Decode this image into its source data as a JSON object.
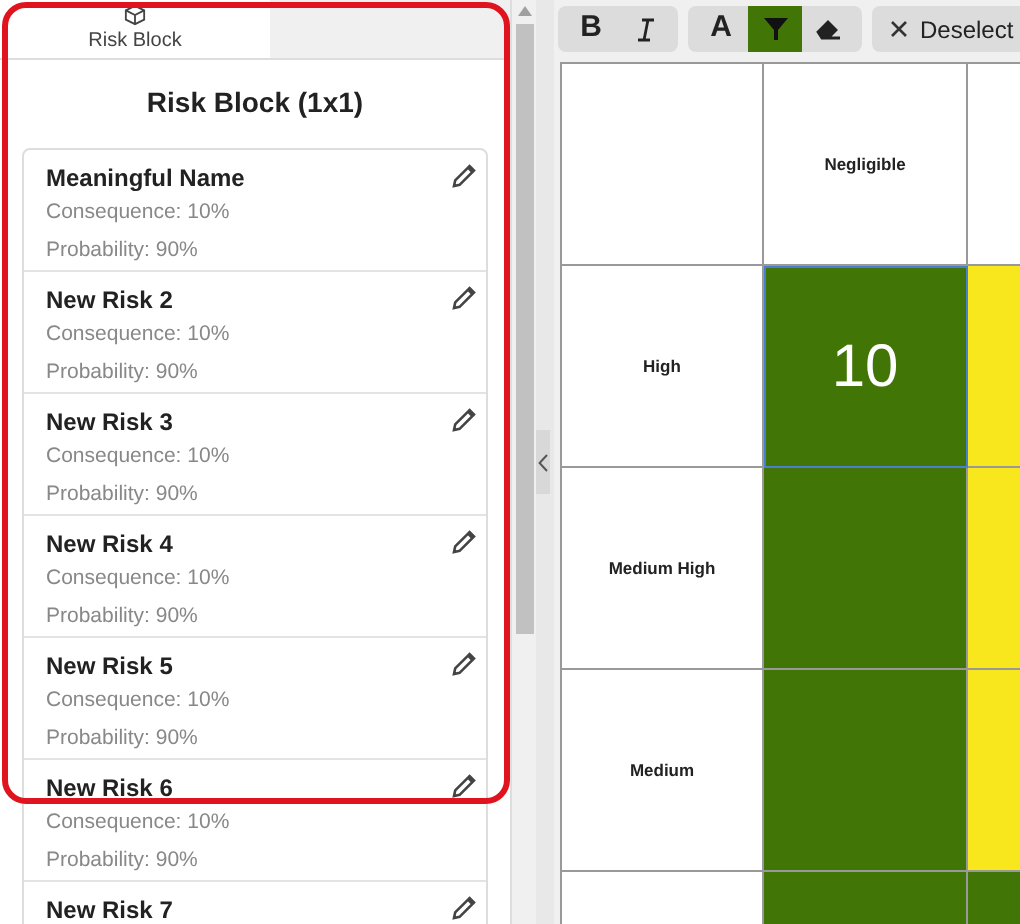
{
  "sidebar": {
    "tabs": [
      {
        "label": "Risk Block",
        "selected": true
      }
    ],
    "title": "Risk Block (1x1)",
    "highlighted": true,
    "risks": [
      {
        "name": "Meaningful Name",
        "consequence": "Consequence: 10%",
        "probability": "Probability: 90%"
      },
      {
        "name": "New Risk 2",
        "consequence": "Consequence: 10%",
        "probability": "Probability: 90%"
      },
      {
        "name": "New Risk 3",
        "consequence": "Consequence: 10%",
        "probability": "Probability: 90%"
      },
      {
        "name": "New Risk 4",
        "consequence": "Consequence: 10%",
        "probability": "Probability: 90%"
      },
      {
        "name": "New Risk 5",
        "consequence": "Consequence: 10%",
        "probability": "Probability: 90%"
      },
      {
        "name": "New Risk 6",
        "consequence": "Consequence: 10%",
        "probability": "Probability: 90%"
      },
      {
        "name": "New Risk 7"
      }
    ]
  },
  "toolbar": {
    "groups": [
      [
        {
          "kind": "bold",
          "glyph": "B",
          "selected": false
        },
        {
          "kind": "italic",
          "selected": false
        }
      ],
      [
        {
          "kind": "text-color",
          "glyph": "A",
          "selected": false
        },
        {
          "kind": "fill-color",
          "selected": true
        },
        {
          "kind": "eraser",
          "selected": false
        }
      ],
      [
        {
          "kind": "deselect",
          "label": "Deselect",
          "selected": false
        }
      ]
    ]
  },
  "matrix": {
    "column_headers": [
      "Negligible"
    ],
    "rows": [
      {
        "label": "High",
        "cells": [
          {
            "color": "#417505",
            "value": "10",
            "selected": true
          },
          {
            "color": "#f8e71c",
            "selected": false
          }
        ]
      },
      {
        "label": "Medium High",
        "cells": [
          {
            "color": "#417505",
            "selected": false
          },
          {
            "color": "#f8e71c",
            "selected": false
          }
        ]
      },
      {
        "label": "Medium",
        "cells": [
          {
            "color": "#417505",
            "selected": false
          },
          {
            "color": "#f8e71c",
            "selected": false
          }
        ]
      },
      {
        "cells": [
          {
            "color": "#417505",
            "selected": false
          },
          {
            "color": "#417505",
            "selected": false
          }
        ]
      }
    ]
  }
}
